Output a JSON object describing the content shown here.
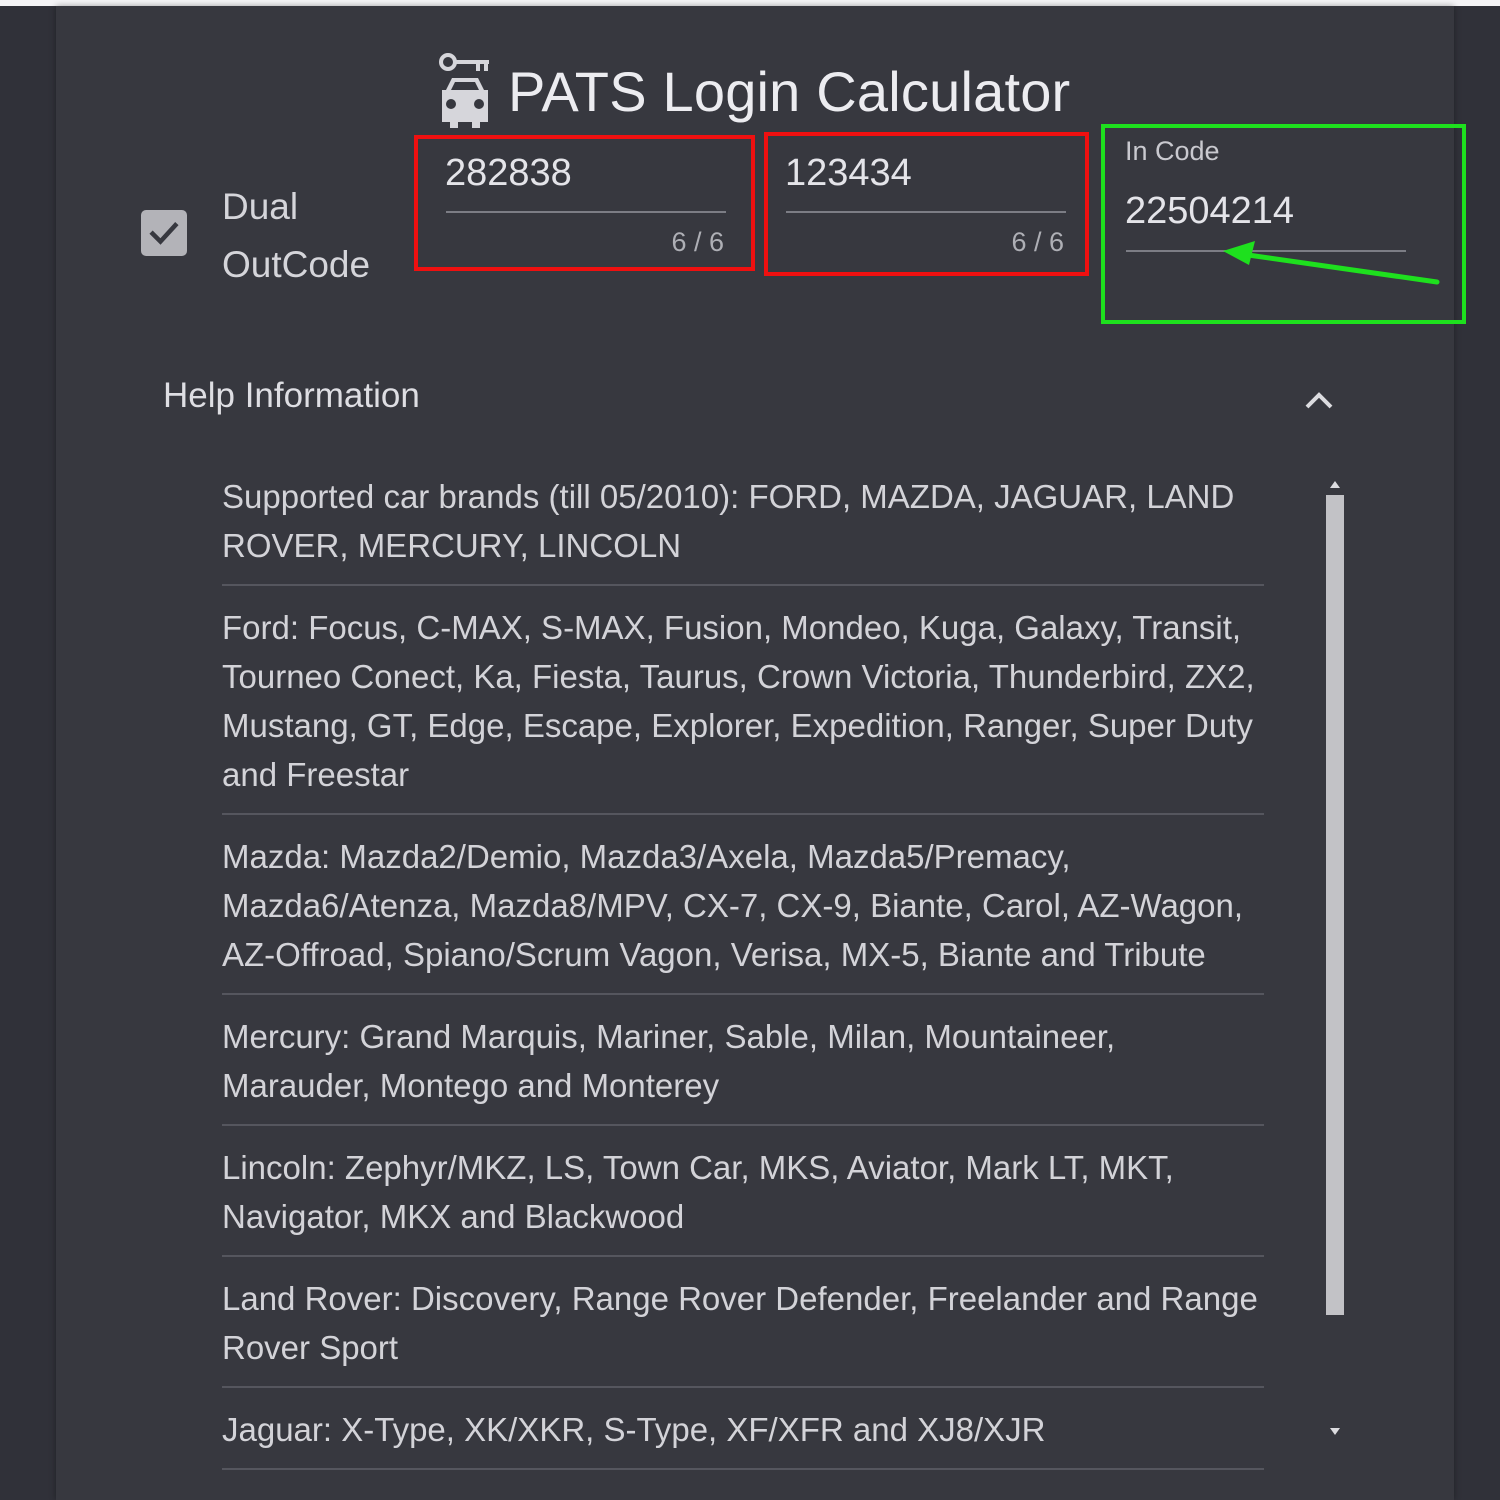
{
  "header": {
    "title": "PATS Login Calculator",
    "icon": "car-key-icon"
  },
  "dual_outcode": {
    "checked": true,
    "label": "Dual OutCode"
  },
  "outcode_fields": [
    {
      "value": "282838",
      "counter": "6 / 6"
    },
    {
      "value": "123434",
      "counter": "6 / 6"
    }
  ],
  "incode_field": {
    "label": "In Code",
    "value": "22504214"
  },
  "help": {
    "title": "Help Information",
    "items": [
      "Supported car brands (till 05/2010): FORD, MAZDA, JAGUAR, LAND ROVER, MERCURY, LINCOLN",
      "Ford: Focus, C-MAX, S-MAX, Fusion, Mondeo, Kuga, Galaxy, Transit, Tourneo Conect, Ka, Fiesta, Taurus, Crown Victoria, Thunderbird, ZX2, Mustang, GT, Edge, Escape, Explorer, Expedition, Ranger, Super Duty and Freestar",
      "Mazda: Mazda2/Demio, Mazda3/Axela, Mazda5/Premacy, Mazda6/Atenza, Mazda8/MPV, CX-7, CX-9, Biante, Carol, AZ-Wagon, AZ-Offroad, Spiano/Scrum Vagon, Verisa, MX-5, Biante and Tribute",
      "Mercury: Grand Marquis, Mariner, Sable, Milan, Mountaineer, Marauder, Montego and Monterey",
      "Lincoln: Zephyr/MKZ, LS, Town Car, MKS, Aviator, Mark LT, MKT, Navigator, MKX and Blackwood",
      "Land Rover: Discovery, Range Rover Defender, Freelander and Range Rover Sport",
      "Jaguar: X-Type, XK/XKR, S-Type, XF/XFR and XJ8/XJR"
    ]
  },
  "colors": {
    "highlight_red": "#ef1010",
    "highlight_green": "#1ee01e",
    "panel": "#37383f",
    "background": "#303139"
  }
}
